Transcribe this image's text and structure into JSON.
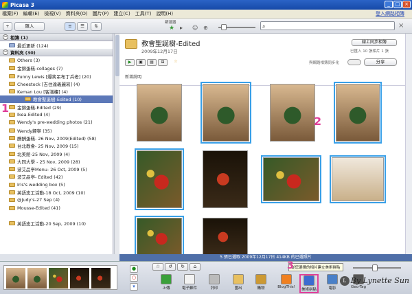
{
  "window": {
    "title": "Picasa 3"
  },
  "menu": {
    "items": [
      "檔案(F)",
      "編輯(E)",
      "檢視(V)",
      "資料夾(O)",
      "圖片(P)",
      "建立(C)",
      "工具(T)",
      "說明(H)"
    ],
    "signin": "登入網路相簿"
  },
  "toolbar": {
    "import_label": "匯入",
    "filter_label": "篩選器",
    "search_placeholder": "",
    "clear_icon": "×"
  },
  "sidebar": {
    "albums_header": "相簿 (1)",
    "recent": "最近更新 (124)",
    "folders_header": "資料夾 (30)",
    "folders": [
      {
        "label": "Others (3)"
      },
      {
        "label": "金錦蛋糕-collages (7)"
      },
      {
        "label": "Funny Lewis [爆笑吊布丁兵老] (20)"
      },
      {
        "label": "Cheestock [吉住達義麗寫] (4)"
      },
      {
        "label": "Keman Lou [客滿樓] (4)"
      },
      {
        "label": "教會聖誕樹-Edited (10)",
        "selected": true
      },
      {
        "label": "金錦蛋糕-Edited (29)"
      },
      {
        "label": "Ikea-Edited (4)"
      },
      {
        "label": "Wendy's pre-wedding photos (21)"
      },
      {
        "label": "Wendy歸寧 (35)"
      },
      {
        "label": "酬酬蛋糕- 26 Nov, 2009(Edited) (58)"
      },
      {
        "label": "台北教會- 25 Nov, 2009 (15)"
      },
      {
        "label": "北美館-25 Nov, 2009 (4)"
      },
      {
        "label": "大同大學 - 25 Nov, 2009 (28)"
      },
      {
        "label": "波艾品亭Menu- 26 Oct, 2009 (5)"
      },
      {
        "label": "波艾品亭- Edited (42)"
      },
      {
        "label": "Iris's wedding box (5)"
      },
      {
        "label": "英語志工活動-18 Oct, 2009 (10)"
      },
      {
        "label": "@Judy's-27 Sep (4)"
      },
      {
        "label": "Mousse-Edited (41)"
      },
      {
        "label": ""
      },
      {
        "label": "英語志工活動-20 Sep, 2009 (10)"
      }
    ],
    "annotation": "1"
  },
  "album": {
    "title": "教會聖誕樹-Edited",
    "date": "2009年12月17日",
    "share_button": "線上同步相簿",
    "count": "已匯入 10 張相片 1 張",
    "sync_label": "與網路相簿同步化",
    "share_label": "分享",
    "caption": "新增說明",
    "annotation": "2"
  },
  "photos": [
    {
      "style": "tree",
      "selected": false
    },
    {
      "style": "tree",
      "selected": true
    },
    {
      "style": "tree",
      "selected": false
    },
    {
      "style": "tree",
      "selected": true
    },
    {
      "style": "orn",
      "selected": true
    },
    {
      "style": "dark",
      "selected": false
    },
    {
      "style": "orn",
      "selected": true
    },
    {
      "style": "kid",
      "selected": true
    },
    {
      "style": "orn",
      "selected": true
    },
    {
      "style": "dark",
      "selected": false
    }
  ],
  "status": "5 張已選取   2009年12月17日   414KB 的已選照片",
  "bottom": {
    "actions": [
      {
        "label": "上傳"
      },
      {
        "label": "電子郵件"
      },
      {
        "label": "列印"
      },
      {
        "label": "匯出"
      },
      {
        "label": "購物"
      },
      {
        "label": "BlogThis!"
      },
      {
        "label": "美術拼貼",
        "highlight": true
      },
      {
        "label": "電影"
      },
      {
        "label": "Geo-Tag"
      }
    ],
    "tooltip": "從您選擇的相片建立美術拼貼",
    "annotation": "3",
    "signature": "By Lynette Sun"
  },
  "colors": {
    "accent": "#e0409a",
    "selection": "#39a0e8",
    "sidebar_selected": "#5c78b8",
    "statusbar": "#4f6fa8"
  }
}
